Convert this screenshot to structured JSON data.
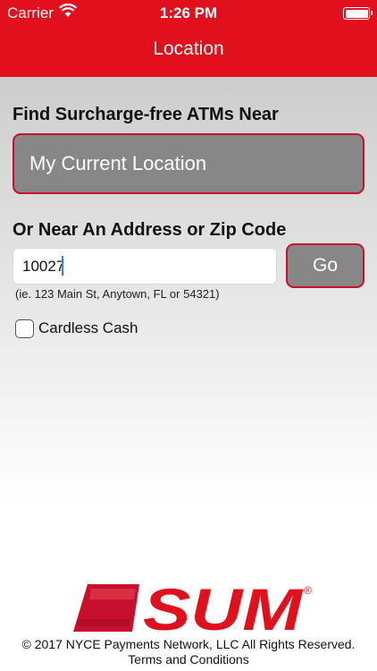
{
  "status_bar": {
    "carrier": "Carrier",
    "time": "1:26 PM"
  },
  "nav": {
    "title": "Location"
  },
  "find": {
    "heading": "Find Surcharge-free ATMs Near",
    "current_location_label": "My Current Location"
  },
  "address": {
    "heading": "Or Near An Address or Zip Code",
    "input_value": "10027",
    "go_label": "Go",
    "hint": "(ie. 123 Main St, Anytown, FL or 54321)"
  },
  "cardless": {
    "label": "Cardless Cash",
    "checked": false
  },
  "logo": {
    "text": "SUM",
    "registered": "®"
  },
  "footer": {
    "copyright": "© 2017 NYCE Payments Network, LLC All Rights Reserved.",
    "terms": "Terms and Conditions"
  },
  "colors": {
    "brand_red": "#e0111d",
    "button_gray": "#878787",
    "button_border": "#c8102e"
  },
  "icons": [
    "wifi-icon",
    "battery-icon",
    "sum-logo-card"
  ]
}
